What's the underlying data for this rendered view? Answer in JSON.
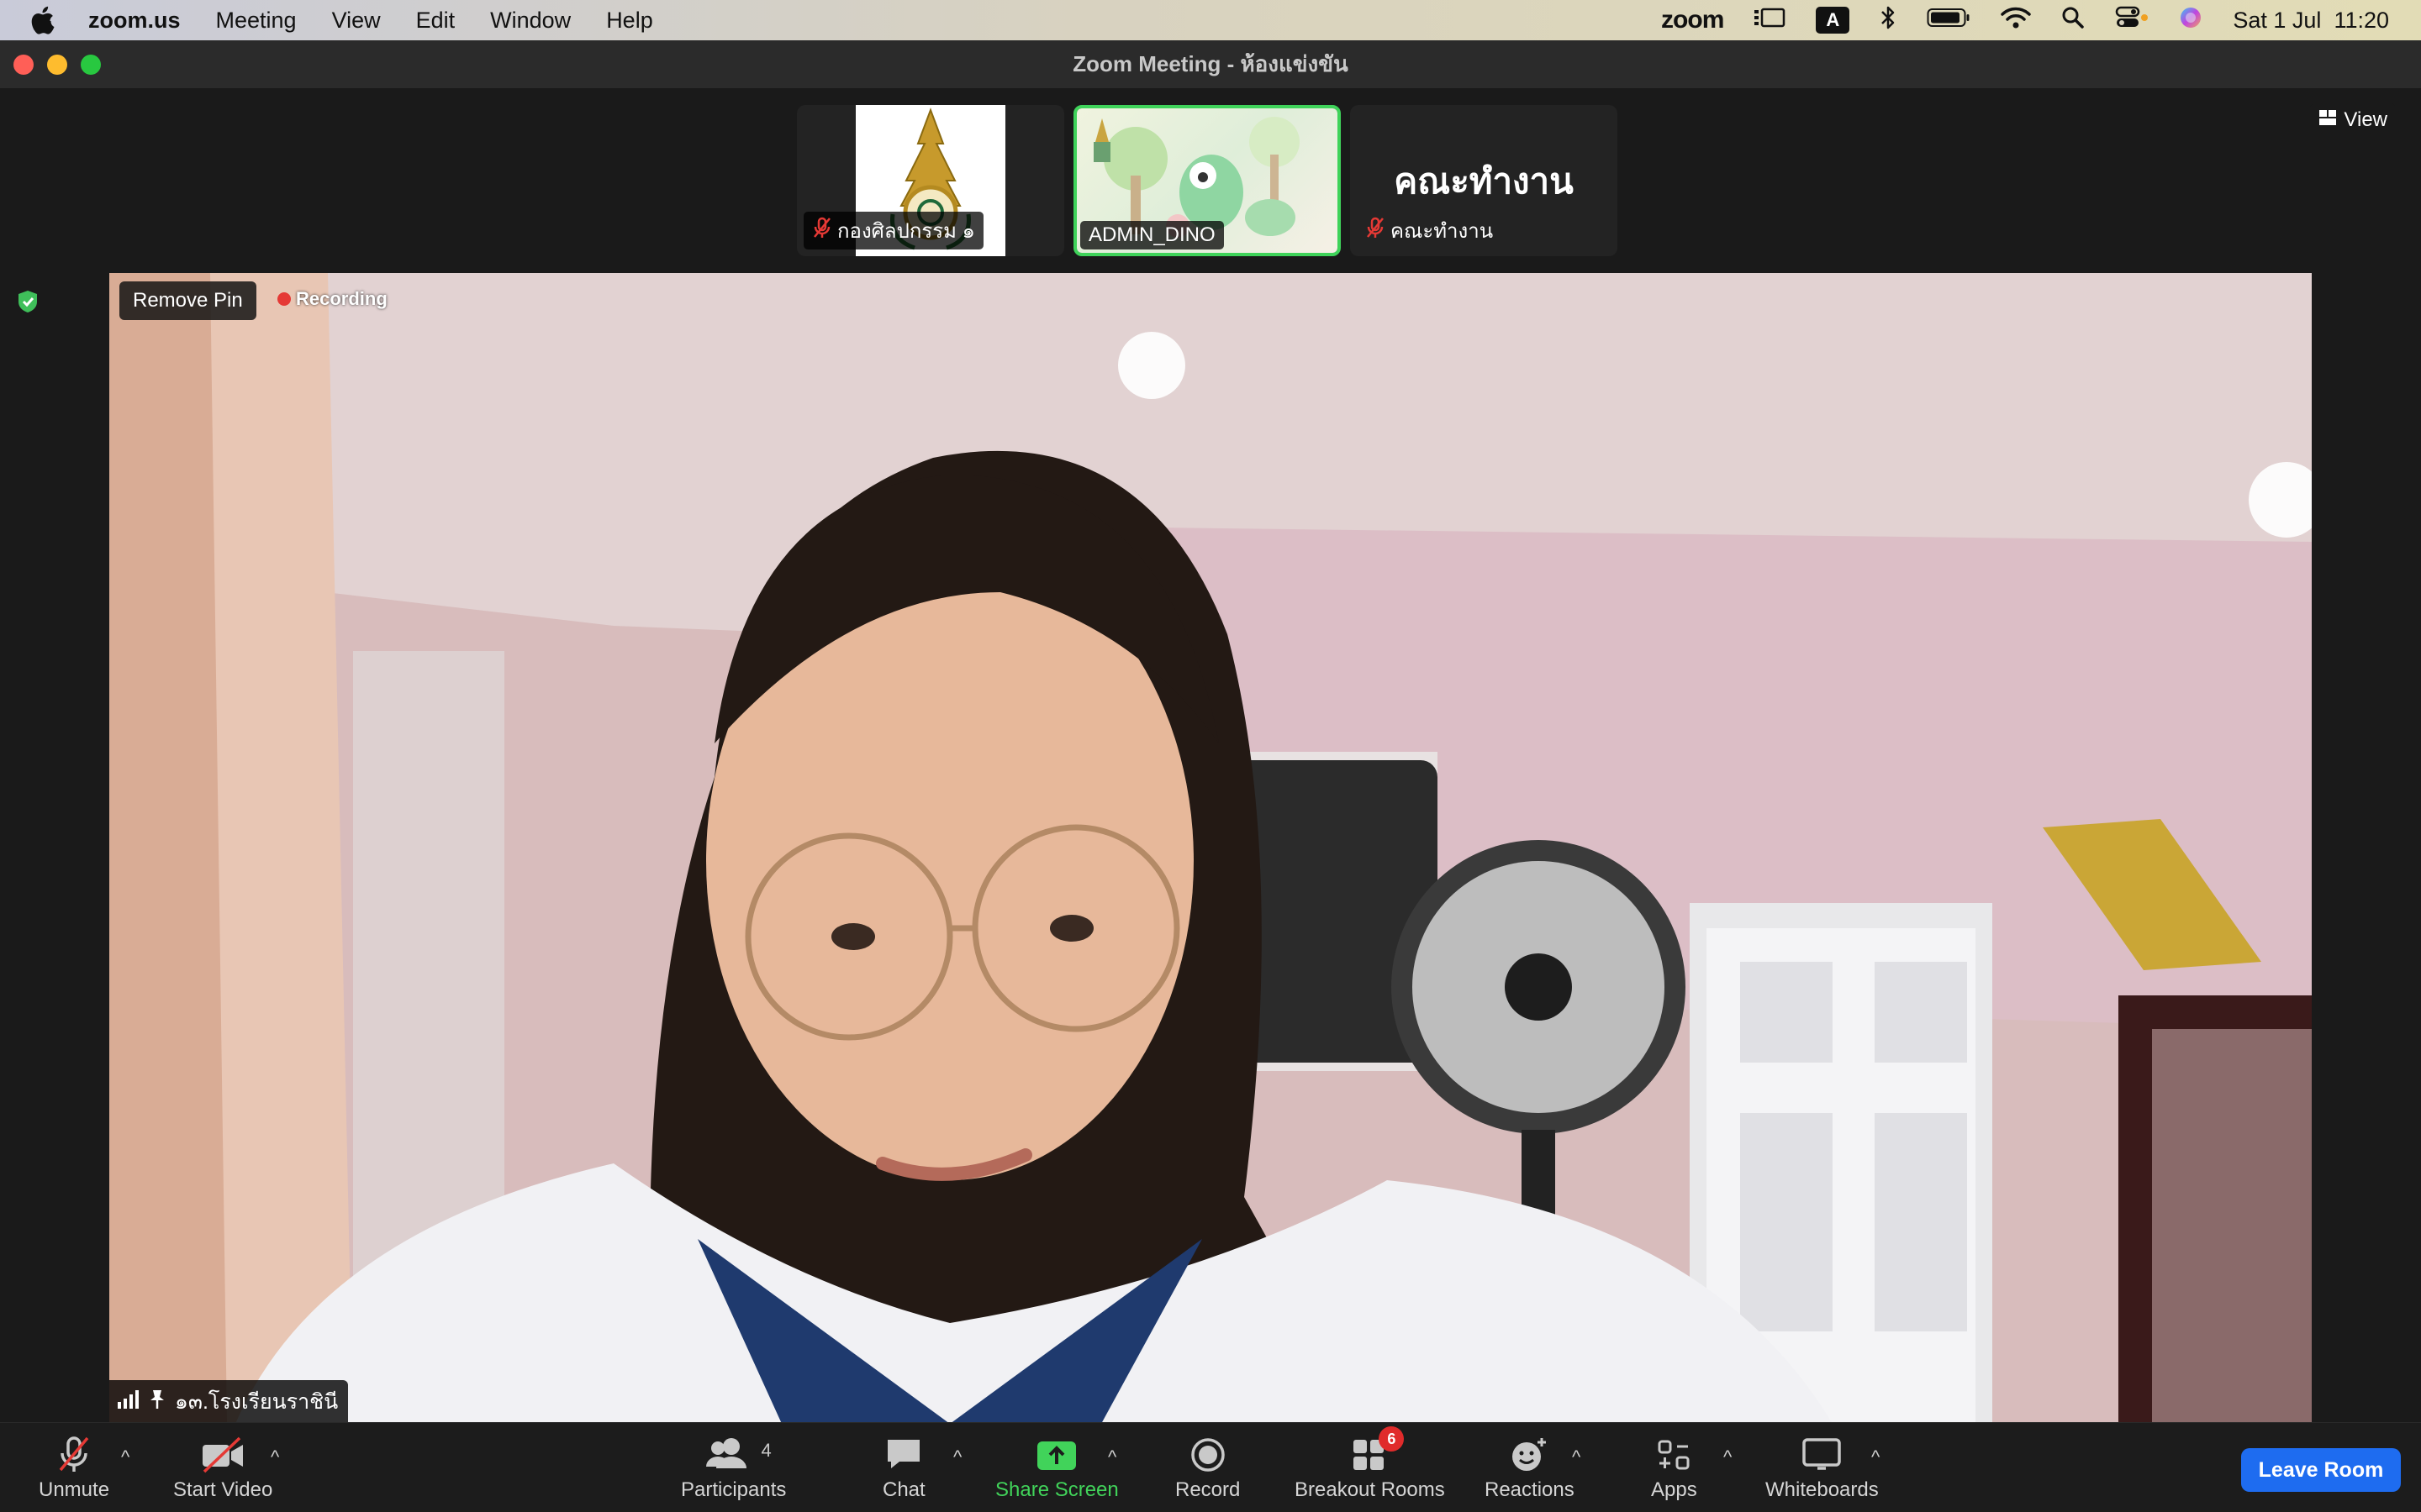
{
  "menubar": {
    "app_name": "zoom.us",
    "items": [
      "Meeting",
      "View",
      "Edit",
      "Window",
      "Help"
    ],
    "zoom_logo": "zoom",
    "keyboard_input": "A",
    "datetime": "Sat 1 Jul  11:20"
  },
  "window": {
    "title": "Zoom Meeting - ห้องแข่งขัน"
  },
  "thumbnails": [
    {
      "name": "กองศิลปกรรม ๑",
      "muted": true
    },
    {
      "name": "ADMIN_DINO",
      "muted": false,
      "active": true
    },
    {
      "name": "คณะทำงาน",
      "muted": true,
      "display_name": "คณะทำงาน"
    }
  ],
  "view_button": "View",
  "main_video": {
    "pin_button": "Remove Pin",
    "recording_label": "Recording",
    "speaker_name": "๑๓.โรงเรียนราชินี"
  },
  "toolbar": {
    "unmute": "Unmute",
    "start_video": "Start Video",
    "participants": "Participants",
    "participants_count": "4",
    "chat": "Chat",
    "share_screen": "Share Screen",
    "record": "Record",
    "breakout_rooms": "Breakout Rooms",
    "breakout_badge": "6",
    "reactions": "Reactions",
    "apps": "Apps",
    "whiteboards": "Whiteboards",
    "leave_room": "Leave Room"
  },
  "colors": {
    "active_border": "#3fd35a",
    "share_green": "#41d35a",
    "leave_blue": "#1e6cf0",
    "recording_red": "#e53935"
  }
}
